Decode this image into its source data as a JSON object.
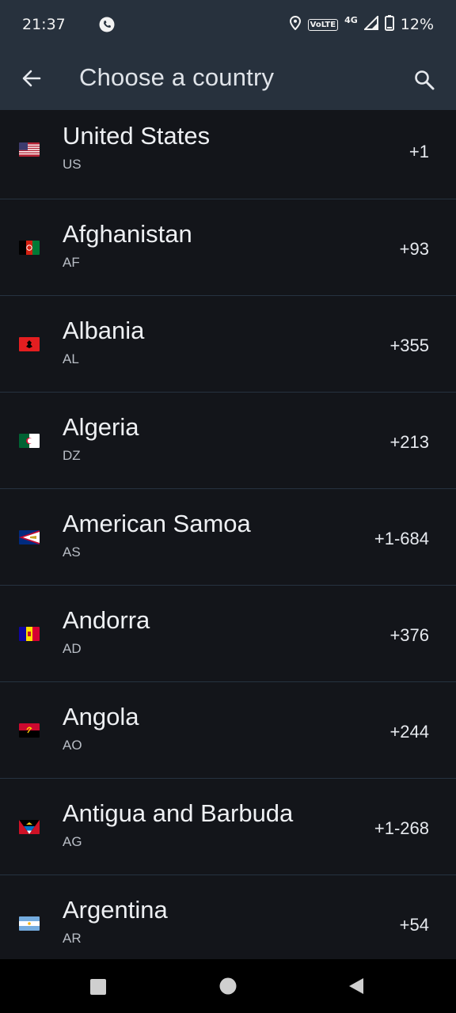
{
  "status": {
    "time": "21:37",
    "volte": "VoLTE",
    "network": "4G",
    "battery": "12%"
  },
  "appbar": {
    "title": "Choose a country"
  },
  "countries": [
    {
      "name": "United States",
      "code": "US",
      "dial": "+1"
    },
    {
      "name": "Afghanistan",
      "code": "AF",
      "dial": "+93"
    },
    {
      "name": "Albania",
      "code": "AL",
      "dial": "+355"
    },
    {
      "name": "Algeria",
      "code": "DZ",
      "dial": "+213"
    },
    {
      "name": "American Samoa",
      "code": "AS",
      "dial": "+1-684"
    },
    {
      "name": "Andorra",
      "code": "AD",
      "dial": "+376"
    },
    {
      "name": "Angola",
      "code": "AO",
      "dial": "+244"
    },
    {
      "name": "Antigua and Barbuda",
      "code": "AG",
      "dial": "+1-268"
    },
    {
      "name": "Argentina",
      "code": "AR",
      "dial": "+54"
    }
  ],
  "colors": {
    "appbar_bg": "#27313d",
    "list_bg": "#13151a",
    "divider": "#263240"
  }
}
